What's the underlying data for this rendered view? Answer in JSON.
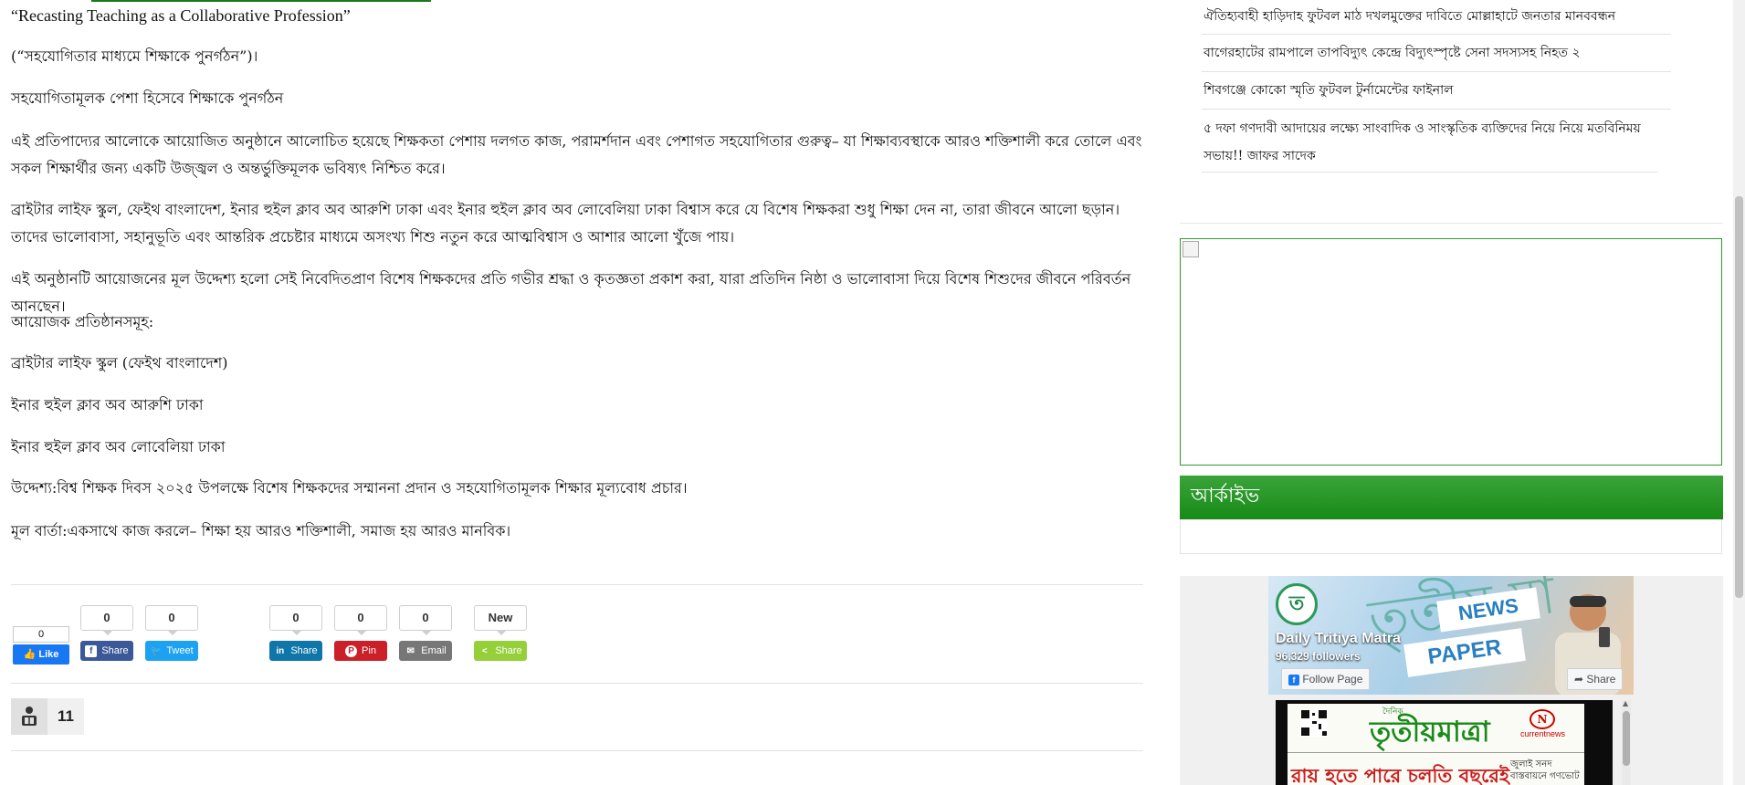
{
  "article": {
    "paragraphs": [
      "“Recasting Teaching as a Collaborative Profession”",
      "(“সহযোগিতার মাধ্যমে শিক্ষাকে পুনর্গঠন”)।",
      "সহযোগিতামূলক পেশা হিসেবে শিক্ষাকে পুনর্গঠন",
      "এই প্রতিপাদ্যের আলোকে আয়োজিত অনুষ্ঠানে আলোচিত হয়েছে শিক্ষকতা পেশায় দলগত কাজ, পরামর্শদান এবং পেশাগত সহযোগিতার গুরুত্ব– যা শিক্ষাব্যবস্থাকে আরও শক্তিশালী করে তোলে এবং সকল শিক্ষার্থীর জন্য একটি উজ্জ্বল ও অন্তর্ভুক্তিমূলক ভবিষ্যৎ নিশ্চিত করে।",
      "ব্রাইটার লাইফ স্কুল, ফেইথ বাংলাদেশ, ইনার হুইল ক্লাব অব আরুশি ঢাকা এবং ইনার হুইল ক্লাব অব লোবেলিয়া ঢাকা বিশ্বাস করে যে বিশেষ শিক্ষকরা শুধু শিক্ষা দেন না, তারা জীবনে আলো ছড়ান। তাদের ভালোবাসা, সহানুভূতি এবং আন্তরিক প্রচেষ্টার মাধ্যমে অসংখ্য শিশু নতুন করে আত্মবিশ্বাস ও আশার আলো খুঁজে পায়।",
      "এই অনুষ্ঠানটি আয়োজনের মূল উদ্দেশ্য হলো সেই নিবেদিতপ্রাণ বিশেষ শিক্ষকদের প্রতি গভীর শ্রদ্ধা ও কৃতজ্ঞতা প্রকাশ করা, যারা প্রতিদিন নিষ্ঠা ও ভালোবাসা দিয়ে বিশেষ শিশুদের জীবনে পরিবর্তন আনছেন।",
      "আয়োজক প্রতিষ্ঠানসমূহ:",
      "ব্রাইটার লাইফ স্কুল (ফেইথ বাংলাদেশ)",
      "ইনার হুইল ক্লাব অব আরুশি ঢাকা",
      "ইনার হুইল ক্লাব অব লোবেলিয়া ঢাকা",
      "উদ্দেশ্য:বিশ্ব শিক্ষক দিবস ২০২৫ উপলক্ষে বিশেষ শিক্ষকদের সম্মাননা প্রদান ও সহযোগিতামূলক শিক্ষার মূল্যবোধ প্রচার।",
      "মূল বার্তা:একসাথে কাজ করলে– শিক্ষা হয় আরও শক্তিশালী, সমাজ হয় আরও মানবিক।"
    ]
  },
  "share": {
    "fb_like": {
      "count": "0",
      "label": "Like"
    },
    "buttons": [
      {
        "count": "0",
        "label": "Share",
        "color": "#3b5998",
        "icon": "facebook-icon"
      },
      {
        "count": "0",
        "label": "Tweet",
        "color": "#1da1f2",
        "icon": "twitter-icon"
      },
      {
        "count": "0",
        "label": "Share",
        "color": "#0e76a8",
        "icon": "linkedin-icon"
      },
      {
        "count": "0",
        "label": "Pin",
        "color": "#cb2027",
        "icon": "pinterest-icon"
      },
      {
        "count": "0",
        "label": "Email",
        "color": "#777777",
        "icon": "email-icon"
      },
      {
        "count": "New",
        "label": "Share",
        "color": "#95d03a",
        "icon": "share-icon"
      }
    ]
  },
  "reader_count": "11",
  "sidebar": {
    "news": [
      "ঐতিহ্যবাহী হাড়িদাহ ফুটবল মাঠ দখলমুক্তের দাবিতে মোল্লাহাটে জনতার মানববন্ধন",
      "বাগেরহাটের রামপালে তাপবিদ্যুৎ কেন্দ্রে বিদ্যুৎস্পৃষ্টে সেনা সদস্যসহ নিহত ২",
      "শিবগঞ্জে কোকো স্মৃতি ফুটবল টুর্নামেন্টের ফাইনাল",
      "৫ দফা গণদাবী আদায়ের লক্ষ্যে সাংবাদিক ও সাংস্কৃতিক ব্যক্তিদের নিয়ে নিয়ে মতবিনিময় সভায়!! জাফর সাদেক"
    ],
    "archive_title": "আর্কাইভ",
    "fb_page": {
      "name": "Daily Tritiya Matra",
      "followers": "96,329 followers",
      "follow_label": "Follow Page",
      "share_label": "Share",
      "banner_word": "তৃতীয় মা",
      "tag1": "NEWS",
      "tag2": "PAPER"
    },
    "newspaper": {
      "kicker": "দৈনিক",
      "title": "তৃতীয়মাত্রা",
      "headline_left": "রায় হতে পারে চলতি বছরেই",
      "headline_right": "জুলাই সনদ বাস্তবায়নে গণভোট",
      "logo_text": "currentnews"
    }
  },
  "colors": {
    "accent_green": "#1a8a1a",
    "fb_blue": "#1877f2"
  }
}
